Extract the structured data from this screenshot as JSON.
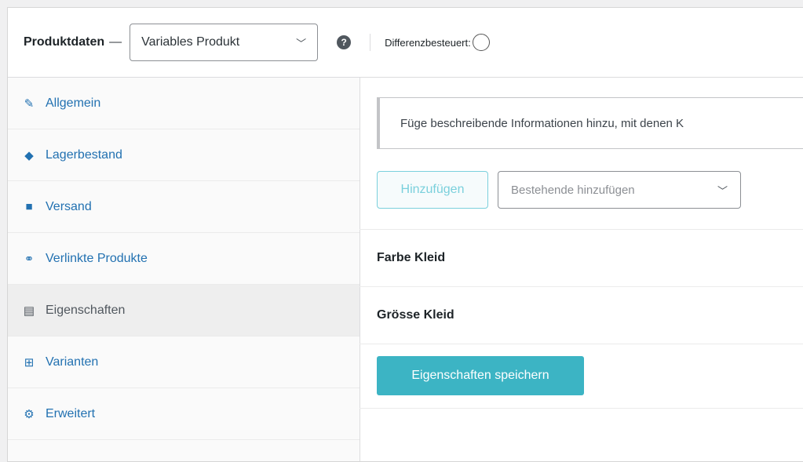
{
  "header": {
    "title": "Produktdaten",
    "dash": "—",
    "product_type": "Variables Produkt",
    "help_icon": "help-icon",
    "taxed_label": "Differenzbesteuert:"
  },
  "tabs": [
    {
      "label": "Allgemein",
      "icon": "wrench-icon",
      "glyph": "✎",
      "active": false
    },
    {
      "label": "Lagerbestand",
      "icon": "tag-icon",
      "glyph": "◆",
      "active": false
    },
    {
      "label": "Versand",
      "icon": "truck-icon",
      "glyph": "■",
      "active": false
    },
    {
      "label": "Verlinkte Produkte",
      "icon": "link-icon",
      "glyph": "⚭",
      "active": false
    },
    {
      "label": "Eigenschaften",
      "icon": "list-icon",
      "glyph": "▤",
      "active": true
    },
    {
      "label": "Varianten",
      "icon": "grid-icon",
      "glyph": "⊞",
      "active": false
    },
    {
      "label": "Erweitert",
      "icon": "gear-icon",
      "glyph": "⚙",
      "active": false
    }
  ],
  "content": {
    "notice": "Füge beschreibende Informationen hinzu, mit denen K",
    "add_button": "Hinzufügen",
    "existing_placeholder": "Bestehende hinzufügen",
    "attributes": [
      "Farbe Kleid",
      "Grösse Kleid"
    ],
    "save_button": "Eigenschaften speichern"
  },
  "colors": {
    "accent": "#3cb4c4",
    "link": "#2271b1"
  }
}
